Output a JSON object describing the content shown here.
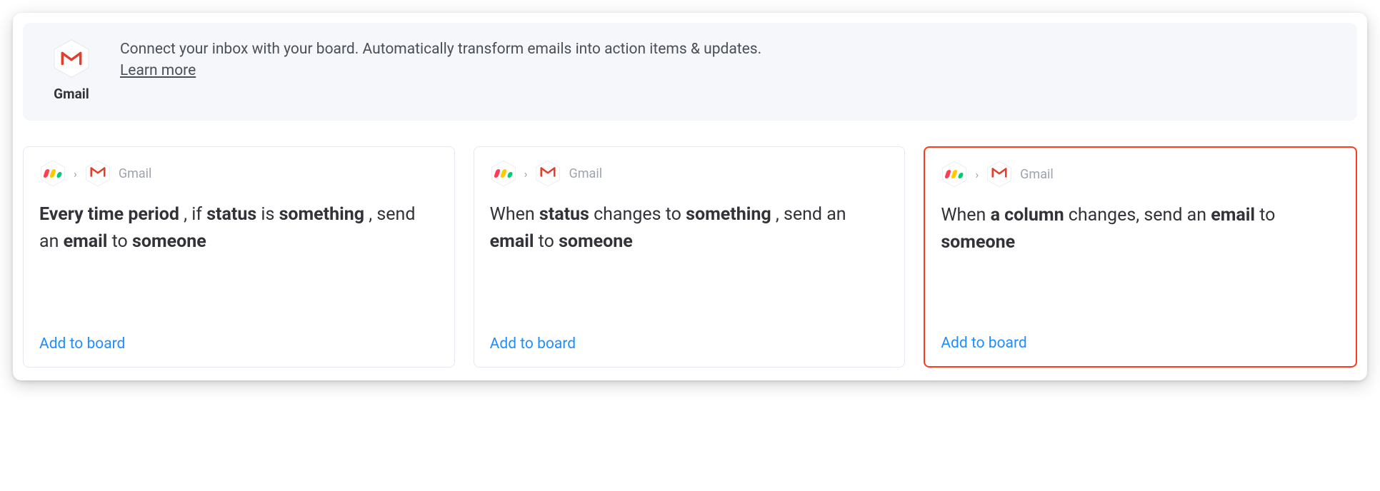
{
  "header": {
    "app_name": "Gmail",
    "description": "Connect your inbox with your board. Automatically transform emails into action items & updates. ",
    "learn_more": "Learn more"
  },
  "breadcrumb": {
    "service": "Gmail"
  },
  "cards": [
    {
      "highlight": false,
      "parts": [
        {
          "t": "Every",
          "b": true
        },
        {
          "t": " ",
          "b": false
        },
        {
          "t": "time period",
          "b": true
        },
        {
          "t": " , if ",
          "b": false
        },
        {
          "t": "status",
          "b": true
        },
        {
          "t": "  is ",
          "b": false
        },
        {
          "t": "something",
          "b": true
        },
        {
          "t": " , send an  ",
          "b": false
        },
        {
          "t": "email",
          "b": true
        },
        {
          "t": "  to ",
          "b": false
        },
        {
          "t": "someone",
          "b": true
        }
      ],
      "cta": "Add to board"
    },
    {
      "highlight": false,
      "parts": [
        {
          "t": "When  ",
          "b": false
        },
        {
          "t": "status",
          "b": true
        },
        {
          "t": "  changes to  ",
          "b": false
        },
        {
          "t": "something",
          "b": true
        },
        {
          "t": " , send an  ",
          "b": false
        },
        {
          "t": "email",
          "b": true
        },
        {
          "t": "  to ",
          "b": false
        },
        {
          "t": "someone",
          "b": true
        }
      ],
      "cta": "Add to board"
    },
    {
      "highlight": true,
      "parts": [
        {
          "t": "When  ",
          "b": false
        },
        {
          "t": "a column",
          "b": true
        },
        {
          "t": "  changes, send an ",
          "b": false
        },
        {
          "t": "email",
          "b": true
        },
        {
          "t": "  to ",
          "b": false
        },
        {
          "t": "someone",
          "b": true
        }
      ],
      "cta": "Add to board"
    }
  ]
}
